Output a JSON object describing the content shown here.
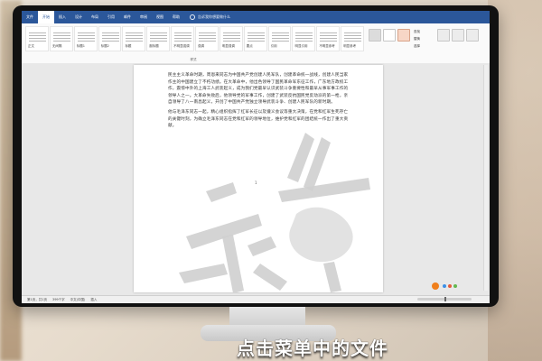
{
  "caption": "点击菜单中的文件",
  "word": {
    "tabs": [
      "文件",
      "开始",
      "插入",
      "设计",
      "布局",
      "引用",
      "邮件",
      "审阅",
      "视图",
      "帮助"
    ],
    "active_tab_index": 1,
    "tell_me": "告诉我你想要做什么",
    "style_gallery": [
      {
        "name": "正文"
      },
      {
        "name": "无间隔"
      },
      {
        "name": "标题1"
      },
      {
        "name": "标题2"
      },
      {
        "name": "标题"
      },
      {
        "name": "副标题"
      },
      {
        "name": "不明显强调"
      },
      {
        "name": "强调"
      },
      {
        "name": "明显强调"
      },
      {
        "name": "要点"
      },
      {
        "name": "引用"
      },
      {
        "name": "明显引用"
      },
      {
        "name": "不明显参考"
      },
      {
        "name": "明显参考"
      }
    ],
    "styles_group_label": "样式",
    "editing_group": {
      "find": "查找",
      "replace": "替换",
      "select": "选择"
    },
    "status": {
      "page": "第1页，共1页",
      "words": "399个字",
      "language": "中文(中国)",
      "mode": "插入"
    },
    "document": {
      "paragraphs": [
        "民主主义革命时期，周恩来同志为中国共产党创建人民军队，创建革命统一战线，创建人民当家作主的中国建立了不朽功绩。在大革命中，他出色领导了国民革命军东征工作，广东地方政权工作，震惊中外的上海工人武装起义，成为我们党最早认识武装斗争重要性和最早从事军事工作的领导人之一。大革命失败后，他领导党的军事工作，创建了武装反抗国民党反动派的第一枪，亲自领导了八一南昌起义，开创了中国共产党独立领导武装斗争、创建人民军队的新时期。",
        "他与毛泽东同志一起，精心组织指挥了红军长征以及遵义会议等重大决策，在党和红军生死存亡的关键时刻，为确立毛泽东同志在党和红军的领导地位，维护党和红军的团结统一作出了重大贡献。"
      ],
      "page_number_label": "1"
    },
    "watermark_text": "紧急"
  }
}
